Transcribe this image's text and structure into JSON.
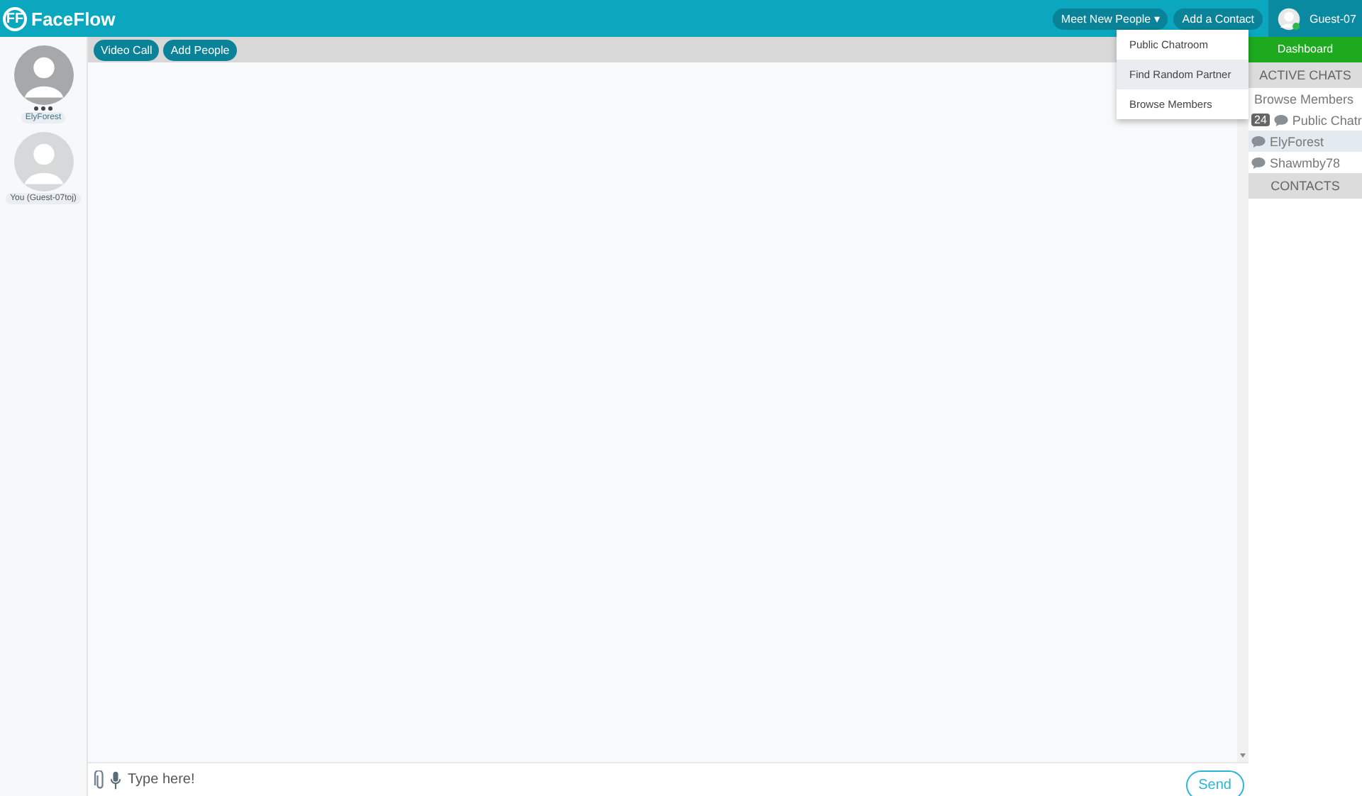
{
  "header": {
    "logo_mark": "FF",
    "logo_text": "FaceFlow",
    "buttons": [
      {
        "label": "Meet New People",
        "caret": "▾"
      },
      {
        "label": "Add a Contact"
      }
    ],
    "user": {
      "name": "Guest-07",
      "online": true
    }
  },
  "menu": {
    "items": [
      {
        "label": "Public Chatroom",
        "selected": false
      },
      {
        "label": "Find Random Partner",
        "selected": true
      },
      {
        "label": "Browse Members",
        "selected": false
      }
    ]
  },
  "participants": [
    {
      "name": "ElyForest",
      "typing": true
    },
    {
      "name": "You (Guest-07toj)",
      "typing": false
    }
  ],
  "toolbar": {
    "buttons": [
      "Video Call",
      "Add People"
    ]
  },
  "composer": {
    "placeholder": "Type here!",
    "send": "Send"
  },
  "sidebar": {
    "dashboard": "Dashboard",
    "active_heading": "ACTIVE CHATS",
    "browse": "Browse Members",
    "chats": [
      {
        "name": "Public Chatr",
        "badge": "24",
        "selected": false
      },
      {
        "name": "ElyForest",
        "selected": true
      },
      {
        "name": "Shawmby78",
        "selected": false
      }
    ],
    "contacts_heading": "CONTACTS"
  }
}
